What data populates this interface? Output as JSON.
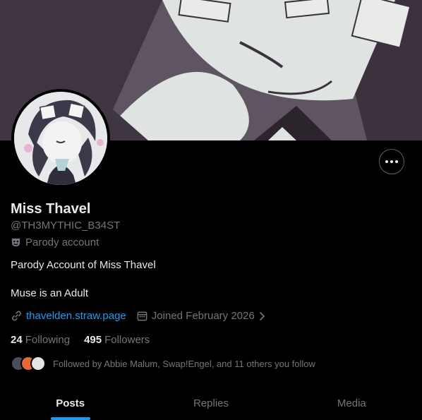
{
  "profile": {
    "name": "Miss Thavel",
    "handle": "@TH3MYTHIC_B34ST",
    "label": "Parody account",
    "bio_line1": "Parody Account of Miss Thavel",
    "bio_line2": "Muse is an Adult",
    "website": "thavelden.straw.page",
    "joined": "Joined February 2026"
  },
  "stats": {
    "following_count": "24",
    "following_label": "Following",
    "followers_count": "495",
    "followers_label": "Followers"
  },
  "followed_by": "Followed by Abbie Malum, Swap!Engel, and 11 others you follow",
  "tabs": [
    {
      "label": "Posts",
      "active": true
    },
    {
      "label": "Replies",
      "active": false
    },
    {
      "label": "Media",
      "active": false
    }
  ],
  "colors": {
    "accent": "#1d9bf0",
    "background": "#000000",
    "muted_text": "#71767b"
  }
}
